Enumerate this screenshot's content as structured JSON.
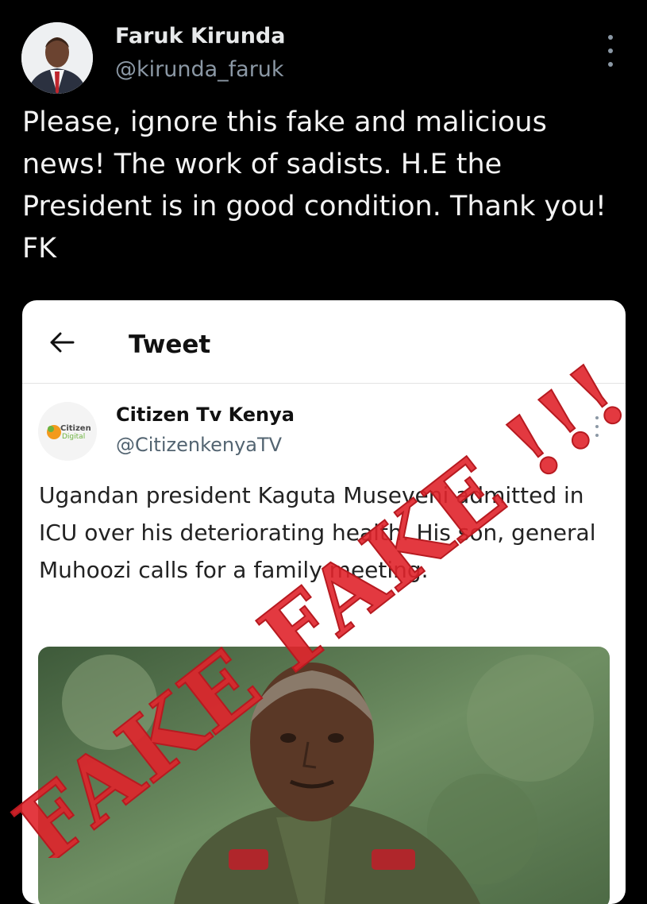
{
  "author": {
    "name": "Faruk Kirunda",
    "handle": "@kirunda_faruk"
  },
  "tweet": {
    "text": "Please, ignore this fake and malicious news! The work of sadists. H.E the President is in good condition. Thank you! FK"
  },
  "quoted_card": {
    "header_title": "Tweet",
    "back_icon": "arrow-left-icon",
    "account": {
      "name": "Citizen Tv Kenya",
      "handle": "@CitizenkenyaTV",
      "logo_line1": "Citizen",
      "logo_line2": "Digital"
    },
    "text": "Ugandan president Kaguta Museveni admitted in ICU over his deteriorating health. His son, general Muhoozi calls for a family meeting."
  },
  "overlay": {
    "stamp_text": "FAKE FAKE !!!",
    "color": "#e0242b"
  },
  "icons": {
    "more_top": "more-vertical-icon",
    "more_quoted": "more-vertical-icon"
  }
}
